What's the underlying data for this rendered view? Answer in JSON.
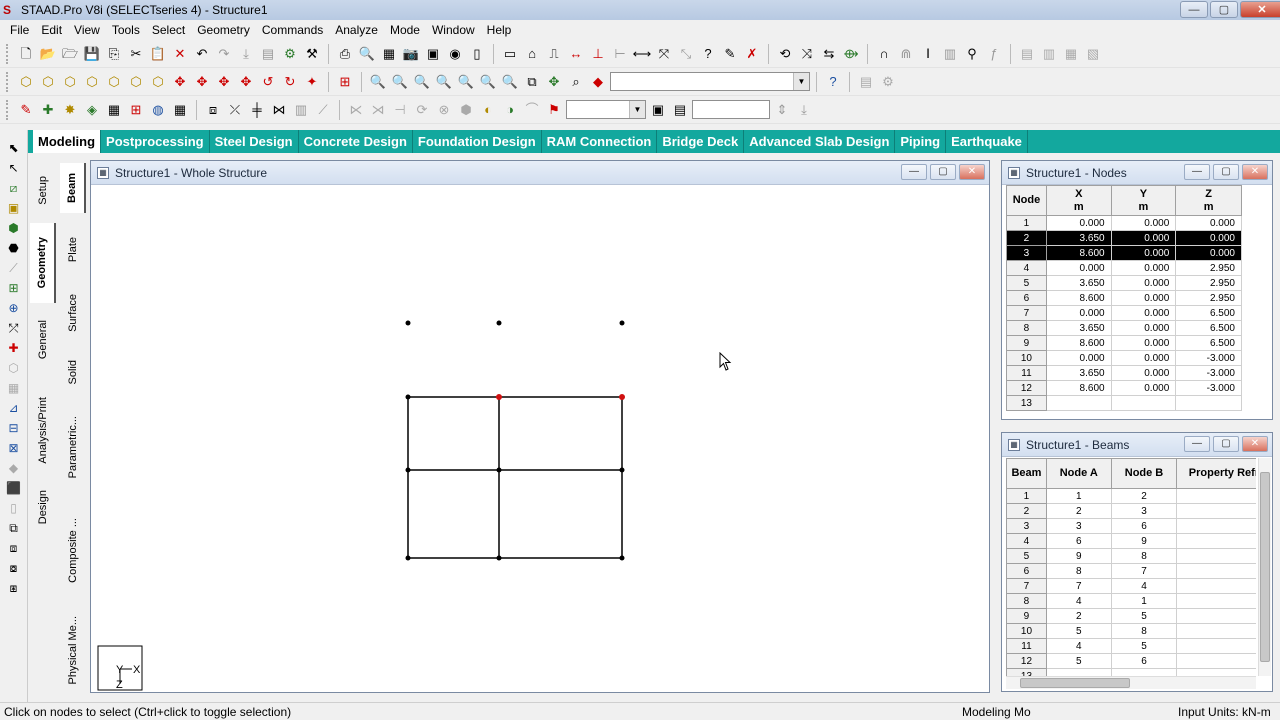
{
  "window": {
    "title": "STAAD.Pro V8i (SELECTseries 4) - Structure1",
    "minimize_glyph": "—",
    "maximize_glyph": "▢",
    "close_glyph": "✕"
  },
  "menu": [
    "File",
    "Edit",
    "View",
    "Tools",
    "Select",
    "Geometry",
    "Commands",
    "Analyze",
    "Mode",
    "Window",
    "Help"
  ],
  "page_tabs": [
    {
      "label": "Modeling",
      "active": true
    },
    {
      "label": "Postprocessing",
      "active": false
    },
    {
      "label": "Steel Design",
      "active": false
    },
    {
      "label": "Concrete Design",
      "active": false
    },
    {
      "label": "Foundation Design",
      "active": false
    },
    {
      "label": "RAM Connection",
      "active": false
    },
    {
      "label": "Bridge Deck",
      "active": false
    },
    {
      "label": "Advanced Slab Design",
      "active": false
    },
    {
      "label": "Piping",
      "active": false
    },
    {
      "label": "Earthquake",
      "active": false
    }
  ],
  "left_vtabs": [
    "Setup",
    "Geometry",
    "General",
    "Analysis/Print",
    "Design"
  ],
  "left_vtabs_active": "Geometry",
  "sub_vtabs": [
    "Beam",
    "Plate",
    "Surface",
    "Solid",
    "Parametric...",
    "Composite ...",
    "Physical Me..."
  ],
  "sub_vtabs_active": "Beam",
  "structure_window": {
    "title": "Structure1 - Whole Structure",
    "axes": {
      "y": "Y",
      "x": "X",
      "z": "Z"
    }
  },
  "nodes_window": {
    "title": "Structure1 - Nodes",
    "headers": [
      {
        "top": "Node",
        "unit": ""
      },
      {
        "top": "X",
        "unit": "m"
      },
      {
        "top": "Y",
        "unit": "m"
      },
      {
        "top": "Z",
        "unit": "m"
      }
    ],
    "rows": [
      {
        "node": "1",
        "x": "0.000",
        "y": "0.000",
        "z": "0.000",
        "selected": false
      },
      {
        "node": "2",
        "x": "3.650",
        "y": "0.000",
        "z": "0.000",
        "selected": true
      },
      {
        "node": "3",
        "x": "8.600",
        "y": "0.000",
        "z": "0.000",
        "selected": true
      },
      {
        "node": "4",
        "x": "0.000",
        "y": "0.000",
        "z": "2.950",
        "selected": false
      },
      {
        "node": "5",
        "x": "3.650",
        "y": "0.000",
        "z": "2.950",
        "selected": false
      },
      {
        "node": "6",
        "x": "8.600",
        "y": "0.000",
        "z": "2.950",
        "selected": false
      },
      {
        "node": "7",
        "x": "0.000",
        "y": "0.000",
        "z": "6.500",
        "selected": false
      },
      {
        "node": "8",
        "x": "3.650",
        "y": "0.000",
        "z": "6.500",
        "selected": false
      },
      {
        "node": "9",
        "x": "8.600",
        "y": "0.000",
        "z": "6.500",
        "selected": false
      },
      {
        "node": "10",
        "x": "0.000",
        "y": "0.000",
        "z": "-3.000",
        "selected": false
      },
      {
        "node": "11",
        "x": "3.650",
        "y": "0.000",
        "z": "-3.000",
        "selected": false
      },
      {
        "node": "12",
        "x": "8.600",
        "y": "0.000",
        "z": "-3.000",
        "selected": false
      },
      {
        "node": "13",
        "x": "",
        "y": "",
        "z": "",
        "selected": false
      }
    ]
  },
  "beams_window": {
    "title": "Structure1 - Beams",
    "headers": [
      "Beam",
      "Node A",
      "Node B",
      "Property Refn"
    ],
    "rows": [
      {
        "beam": "1",
        "a": "1",
        "b": "2"
      },
      {
        "beam": "2",
        "a": "2",
        "b": "3"
      },
      {
        "beam": "3",
        "a": "3",
        "b": "6"
      },
      {
        "beam": "4",
        "a": "6",
        "b": "9"
      },
      {
        "beam": "5",
        "a": "9",
        "b": "8"
      },
      {
        "beam": "6",
        "a": "8",
        "b": "7"
      },
      {
        "beam": "7",
        "a": "7",
        "b": "4"
      },
      {
        "beam": "8",
        "a": "4",
        "b": "1"
      },
      {
        "beam": "9",
        "a": "2",
        "b": "5"
      },
      {
        "beam": "10",
        "a": "5",
        "b": "8"
      },
      {
        "beam": "11",
        "a": "4",
        "b": "5"
      },
      {
        "beam": "12",
        "a": "5",
        "b": "6"
      },
      {
        "beam": "13",
        "a": "",
        "b": ""
      }
    ]
  },
  "statusbar": {
    "hint": "Click on nodes to select (Ctrl+click to toggle selection)",
    "mode": "Modeling Mo",
    "units": "Input Units:  kN-m"
  },
  "colors": {
    "tab_bar": "#13a89e",
    "selected_node": "#d01010",
    "node": "#000000"
  }
}
